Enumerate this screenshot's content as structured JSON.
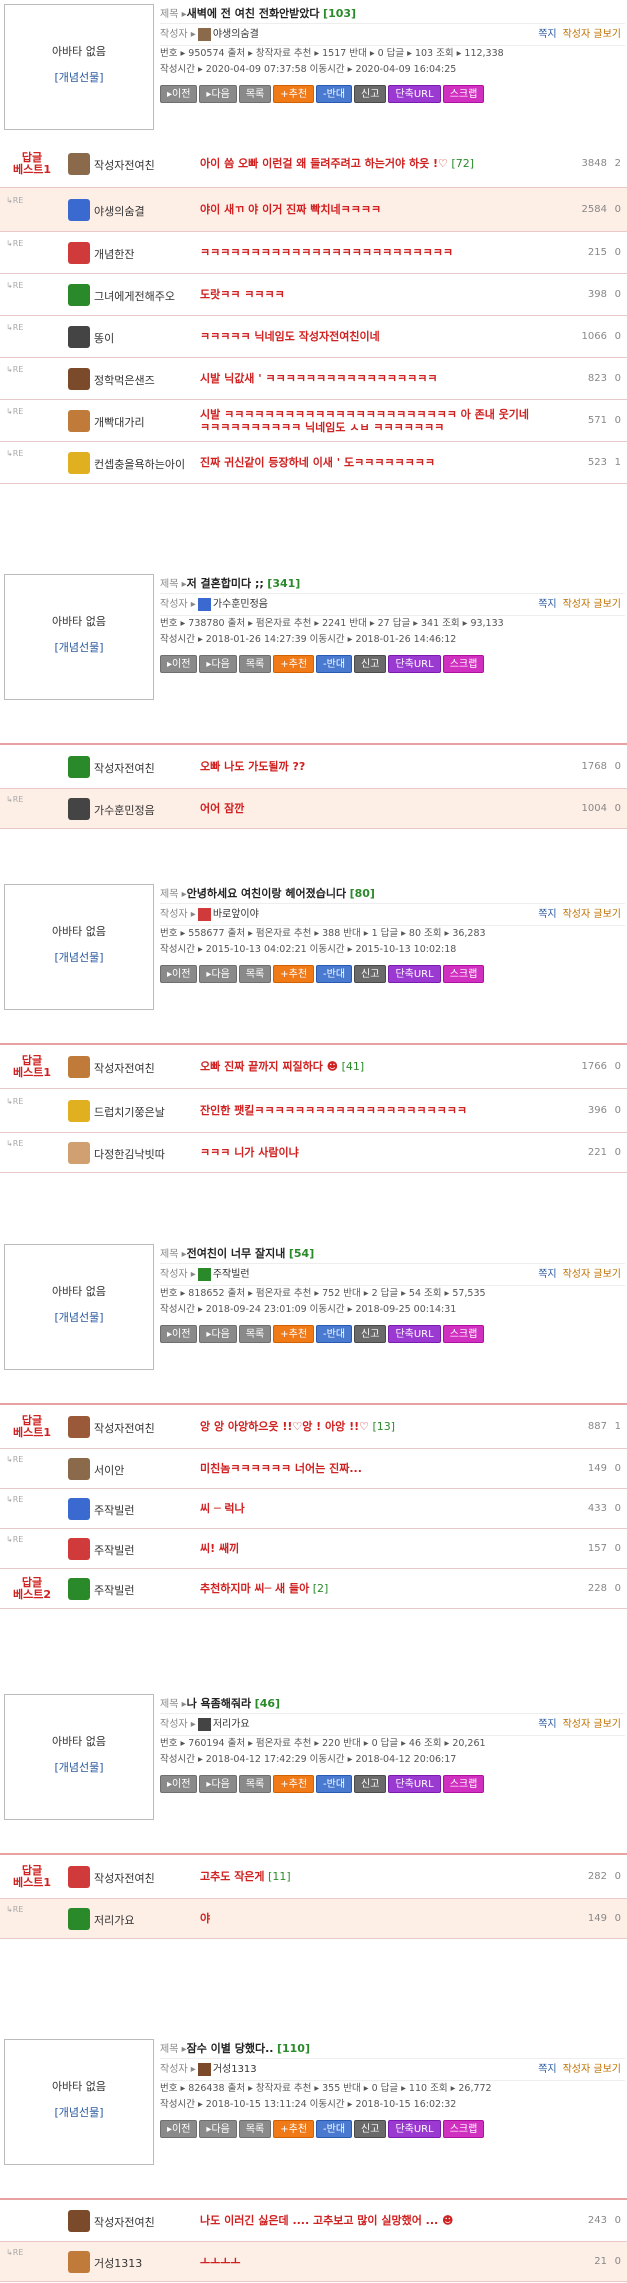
{
  "common": {
    "avatar_label": "아바타 없음",
    "avatar_gift": "[개념선물]",
    "title_label": "제목 ▸",
    "author_label": "작성자 ▸",
    "msg_link": "쪽지",
    "writer_link": "작성자 글보기",
    "re_label": "↳RE",
    "buttons": {
      "prev": "▸이전",
      "next": "▸다음",
      "list": "목록",
      "recommend": "+추천",
      "oppose": "-반대",
      "report": "신고",
      "short_url": "단축URL",
      "scrap": "스크랩"
    }
  },
  "posts": [
    {
      "title": "새벽에 전 여친 전화안받았다",
      "count": "[103]",
      "author": "야생의숨결",
      "meta1": "번호 ▸ 950574   출처 ▸ 창작자료   추천 ▸ 1517   반대 ▸ 0   답글 ▸ 103   조회 ▸ 112,338",
      "meta2": "작성시간 ▸ 2020-04-09 07:37:58   이동시간 ▸ 2020-04-09 16:04:25",
      "comments": [
        {
          "best": "답글\n베스트1",
          "name": "작성자전여친",
          "text": "아이 씀 오빠 이런걸 왜 들려주려고 하는거야 하읏 !♡",
          "cc": " [72]",
          "n1": "3848",
          "n2": "2",
          "hl": false
        },
        {
          "best": "",
          "name": "야생의숨결",
          "text": "야이 새ㄲ 야 이거 진짜 빡치네ㅋㅋㅋㅋ",
          "cc": "",
          "n1": "2584",
          "n2": "0",
          "hl": true
        },
        {
          "best": "",
          "name": "개념한잔",
          "text": "ㅋㅋㅋㅋㅋㅋㅋㅋㅋㅋㅋㅋㅋㅋㅋㅋㅋㅋㅋㅋㅋㅋㅋㅋㅋ",
          "cc": "",
          "n1": "215",
          "n2": "0",
          "hl": false
        },
        {
          "best": "",
          "name": "그녀에게전해주오",
          "text": "도랏ㅋㅋ ㅋㅋㅋㅋ",
          "cc": "",
          "n1": "398",
          "n2": "0",
          "hl": false
        },
        {
          "best": "",
          "name": "똥이",
          "text": "ㅋㅋㅋㅋㅋ 닉네임도 작성자전여친이네",
          "cc": "",
          "n1": "1066",
          "n2": "0",
          "hl": false
        },
        {
          "best": "",
          "name": "정학먹은샌즈",
          "text": "시발 닉값새 ' ㅋㅋㅋㅋㅋㅋㅋㅋㅋㅋㅋㅋㅋㅋㅋㅋㅋ",
          "cc": "",
          "n1": "823",
          "n2": "0",
          "hl": false
        },
        {
          "best": "",
          "name": "개빡대가리",
          "text": "시발 ㅋㅋㅋㅋㅋㅋㅋㅋㅋㅋㅋㅋㅋㅋㅋㅋㅋㅋㅋㅋㅋㅋㅋ 아 존내 웃기네 ㅋㅋㅋㅋㅋㅋㅋㅋㅋㅋ 닉네임도 ㅅㅂ ㅋㅋㅋㅋㅋㅋㅋ",
          "cc": "",
          "n1": "571",
          "n2": "0",
          "hl": false
        },
        {
          "best": "",
          "name": "컨셉충을욕하는아이",
          "text": "진짜 귀신같이 등장하네 이새 ' 도ㅋㅋㅋㅋㅋㅋㅋㅋ",
          "cc": "",
          "n1": "523",
          "n2": "1",
          "hl": false
        }
      ]
    },
    {
      "title": "저 결혼합미다 ;;",
      "count": "[341]",
      "author": "가수훈민정음",
      "meta1": "번호 ▸ 738780   출처 ▸ 펌온자료   추천 ▸ 2241   반대 ▸ 27   답글 ▸ 341   조회 ▸ 93,133",
      "meta2": "작성시간 ▸ 2018-01-26 14:27:39   이동시간 ▸ 2018-01-26 14:46:12",
      "comments": [
        {
          "best": "",
          "name": "작성자전여친",
          "text": "오빠 나도 가도될까 ??",
          "cc": "",
          "n1": "1768",
          "n2": "0",
          "hl": false
        },
        {
          "best": "",
          "name": "가수훈민정음",
          "text": "어어 잠깐",
          "cc": "",
          "n1": "1004",
          "n2": "0",
          "hl": true
        }
      ]
    },
    {
      "title": "안녕하세요 여친이랑 헤어졌습니다",
      "count": "[80]",
      "author": "바로앞이야",
      "meta1": "번호 ▸ 558677   출처 ▸ 펌온자료   추천 ▸ 388   반대 ▸ 1   답글 ▸ 80   조회 ▸ 36,283",
      "meta2": "작성시간 ▸ 2015-10-13 04:02:21   이동시간 ▸ 2015-10-13 10:02:18",
      "comments": [
        {
          "best": "답글\n베스트1",
          "name": "작성자전여친",
          "text": "오빠 진짜 끝까지 찌질하다 ☻",
          "cc": " [41]",
          "n1": "1766",
          "n2": "0",
          "hl": false
        },
        {
          "best": "",
          "name": "드럽치기쭝은날",
          "text": "잔인한 팻킬ㅋㅋㅋㅋㅋㅋㅋㅋㅋㅋㅋㅋㅋㅋㅋㅋㅋㅋㅋㅋㅋ",
          "cc": "",
          "n1": "396",
          "n2": "0",
          "hl": false
        },
        {
          "best": "",
          "name": "다정한김낙빗따",
          "text": "ㅋㅋㅋ 니가 사람이냐",
          "cc": "",
          "n1": "221",
          "n2": "0",
          "hl": false
        }
      ]
    },
    {
      "title": "전여친이 너무 잘지내",
      "count": "[54]",
      "author": "주작빌런",
      "meta1": "번호 ▸ 818652   출처 ▸ 펌온자료   추천 ▸ 752   반대 ▸ 2   답글 ▸ 54   조회 ▸ 57,535",
      "meta2": "작성시간 ▸ 2018-09-24 23:01:09   이동시간 ▸ 2018-09-25 00:14:31",
      "comments": [
        {
          "best": "답글\n베스트1",
          "name": "작성자전여친",
          "text": "앙 앙 아앙하으읏 !!♡앙 ! 아앙 !!♡",
          "cc": " [13]",
          "n1": "887",
          "n2": "1",
          "hl": false
        },
        {
          "best": "",
          "name": "서이안",
          "text": "미친놈ㅋㅋㅋㅋㅋㅋ 너어는 진짜...",
          "cc": "",
          "n1": "149",
          "n2": "0",
          "hl": false
        },
        {
          "best": "",
          "name": "주작빌런",
          "text": "씨 ─ 럭나",
          "cc": "",
          "n1": "433",
          "n2": "0",
          "hl": false
        },
        {
          "best": "",
          "name": "주작빌런",
          "text": "씨! 쌔끼",
          "cc": "",
          "n1": "157",
          "n2": "0",
          "hl": false
        },
        {
          "best": "답글\n베스트2",
          "name": "주작빌런",
          "text": "추천하지마 씨─ 새 들아",
          "cc": " [2]",
          "n1": "228",
          "n2": "0",
          "hl": false
        }
      ]
    },
    {
      "title": "나 욕좀해줘라",
      "count": "[46]",
      "author": "저리가요",
      "meta1": "번호 ▸ 760194   출처 ▸ 펌온자료   추천 ▸ 220   반대 ▸ 0   답글 ▸ 46   조회 ▸ 20,261",
      "meta2": "작성시간 ▸ 2018-04-12 17:42:29   이동시간 ▸ 2018-04-12 20:06:17",
      "comments": [
        {
          "best": "답글\n베스트1",
          "name": "작성자전여친",
          "text": "고추도 작은게",
          "cc": " [11]",
          "n1": "282",
          "n2": "0",
          "hl": false
        },
        {
          "best": "",
          "name": "저리가요",
          "text": "야",
          "cc": "",
          "n1": "149",
          "n2": "0",
          "hl": true
        }
      ]
    },
    {
      "title": "잠수 이별 당했다..",
      "count": "[110]",
      "author": "거성1313",
      "meta1": "번호 ▸ 826438   출처 ▸ 창작자료   추천 ▸ 355   반대 ▸ 0   답글 ▸ 110   조회 ▸ 26,772",
      "meta2": "작성시간 ▸ 2018-10-15 13:11:24   이동시간 ▸ 2018-10-15 16:02:32",
      "comments": [
        {
          "best": "",
          "name": "작성자전여친",
          "text": "나도 이러긴 싫은데 .... 고추보고 많이 실망했어 ... ☻",
          "cc": "",
          "n1": "243",
          "n2": "0",
          "hl": false
        },
        {
          "best": "",
          "name": "거성1313",
          "text": "ㅗㅗㅗㅗ",
          "cc": "",
          "n1": "21",
          "n2": "0",
          "hl": true
        }
      ]
    }
  ]
}
